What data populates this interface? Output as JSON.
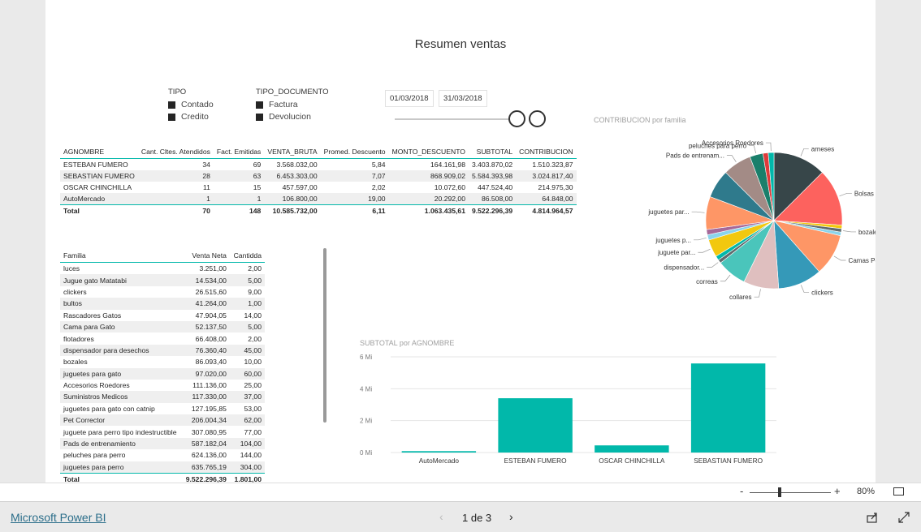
{
  "report": {
    "title": "Resumen ventas"
  },
  "slicer_tipo": {
    "header": "TIPO",
    "options": [
      "Contado",
      "Credito"
    ]
  },
  "slicer_doc": {
    "header": "TIPO_DOCUMENTO",
    "options": [
      "Factura",
      "Devolucion"
    ]
  },
  "date_range": {
    "start": "01/03/2018",
    "end": "31/03/2018"
  },
  "agnombre_table": {
    "headers": [
      "AGNOMBRE",
      "Cant. Cltes. Atendidos",
      "Fact. Emitidas",
      "VENTA_BRUTA",
      "Promed. Descuento",
      "MONTO_DESCUENTO",
      "SUBTOTAL",
      "CONTRIBUCION"
    ],
    "rows": [
      [
        "ESTEBAN FUMERO",
        "34",
        "69",
        "3.568.032,00",
        "5,84",
        "164.161,98",
        "3.403.870,02",
        "1.510.323,87"
      ],
      [
        "SEBASTIAN FUMERO",
        "28",
        "63",
        "6.453.303,00",
        "7,07",
        "868.909,02",
        "5.584.393,98",
        "3.024.817,40"
      ],
      [
        "OSCAR CHINCHILLA",
        "11",
        "15",
        "457.597,00",
        "2,02",
        "10.072,60",
        "447.524,40",
        "214.975,30"
      ],
      [
        "AutoMercado",
        "1",
        "1",
        "106.800,00",
        "19,00",
        "20.292,00",
        "86.508,00",
        "64.848,00"
      ]
    ],
    "total": [
      "Total",
      "70",
      "148",
      "10.585.732,00",
      "6,11",
      "1.063.435,61",
      "9.522.296,39",
      "4.814.964,57"
    ]
  },
  "familia_table": {
    "headers": [
      "Familia",
      "Venta Neta",
      "Cantidda"
    ],
    "rows": [
      [
        "luces",
        "3.251,00",
        "2,00"
      ],
      [
        "Jugue gato Matatabi",
        "14.534,00",
        "5,00"
      ],
      [
        "clickers",
        "26.515,60",
        "9,00"
      ],
      [
        "bultos",
        "41.264,00",
        "1,00"
      ],
      [
        "Rascadores Gatos",
        "47.904,05",
        "14,00"
      ],
      [
        "Cama para Gato",
        "52.137,50",
        "5,00"
      ],
      [
        "flotadores",
        "66.408,00",
        "2,00"
      ],
      [
        "dispensador para desechos",
        "76.360,40",
        "45,00"
      ],
      [
        "bozales",
        "86.093,40",
        "10,00"
      ],
      [
        "juguetes para gato",
        "97.020,00",
        "60,00"
      ],
      [
        "Accesorios Roedores",
        "111.136,00",
        "25,00"
      ],
      [
        "Suministros Medicos",
        "117.330,00",
        "37,00"
      ],
      [
        "juguetes para gato con catnip",
        "127.195,85",
        "53,00"
      ],
      [
        "Pet Corrector",
        "206.004,34",
        "62,00"
      ],
      [
        "juguete para perro tipo indestructible",
        "307.080,95",
        "77,00"
      ],
      [
        "Pads de entrenamiento",
        "587.182,04",
        "104,00"
      ],
      [
        "peluches para perro",
        "624.136,00",
        "144,00"
      ],
      [
        "juguetes para perro",
        "635.765,19",
        "304,00"
      ]
    ],
    "total": [
      "Total",
      "9.522.296,39",
      "1.801,00"
    ]
  },
  "pie_title": "CONTRIBUCION por familia",
  "bar_title": "SUBTOTAL por AGNOMBRE",
  "colors": {
    "accent": "#01b8aa",
    "border": "#01b8aa"
  },
  "chart_data": [
    {
      "type": "pie",
      "title": "CONTRIBUCION por familia",
      "slices": [
        {
          "label": "arneses",
          "value": 12.0,
          "color": "#374649"
        },
        {
          "label": "Bolsas para de...",
          "value": 13.0,
          "color": "#fd625e"
        },
        {
          "label": "",
          "value": 0.8,
          "color": "#f2c80f"
        },
        {
          "label": "bozales",
          "value": 0.8,
          "color": "#5f6b6d"
        },
        {
          "label": "",
          "value": 0.8,
          "color": "#8ad4eb"
        },
        {
          "label": "Camas Perro",
          "value": 9.5,
          "color": "#fe9666"
        },
        {
          "label": "clickers",
          "value": 10.0,
          "color": "#3599b8"
        },
        {
          "label": "collares",
          "value": 8.0,
          "color": "#dfbfbf"
        },
        {
          "label": "correas",
          "value": 6.8,
          "color": "#4ac5bb"
        },
        {
          "label": "dispensador...",
          "value": 0.8,
          "color": "#5f6b6d"
        },
        {
          "label": "",
          "value": 1.0,
          "color": "#01b8aa"
        },
        {
          "label": "juguete par...",
          "value": 4.0,
          "color": "#f2c80f"
        },
        {
          "label": "juguetes p...",
          "value": 1.2,
          "color": "#8ad4eb"
        },
        {
          "label": "",
          "value": 1.2,
          "color": "#a66999"
        },
        {
          "label": "juguetes par...",
          "value": 7.5,
          "color": "#fe9666"
        },
        {
          "label": "",
          "value": 6.5,
          "color": "#2f7a8c"
        },
        {
          "label": "Pads de entrenam...",
          "value": 6.5,
          "color": "#a38b86"
        },
        {
          "label": "peluches para perro",
          "value": 3.0,
          "color": "#1a7f6b"
        },
        {
          "label": "",
          "value": 1.2,
          "color": "#de3b3b"
        },
        {
          "label": "Accesorios Roedores",
          "value": 1.3,
          "color": "#01b8aa"
        }
      ]
    },
    {
      "type": "bar",
      "title": "SUBTOTAL por AGNOMBRE",
      "categories": [
        "AutoMercado",
        "ESTEBAN FUMERO",
        "OSCAR CHINCHILLA",
        "SEBASTIAN FUMERO"
      ],
      "values": [
        86508.0,
        3403870.02,
        447524.4,
        5584393.98
      ],
      "ylim": [
        0,
        6000000
      ],
      "yticks": [
        "0 Mi",
        "2 Mi",
        "4 Mi",
        "6 Mi"
      ],
      "grid": true,
      "color": "#01b8aa"
    }
  ],
  "footer": {
    "brand": "Microsoft Power BI",
    "page": "1 de 3",
    "zoom": "80%"
  }
}
